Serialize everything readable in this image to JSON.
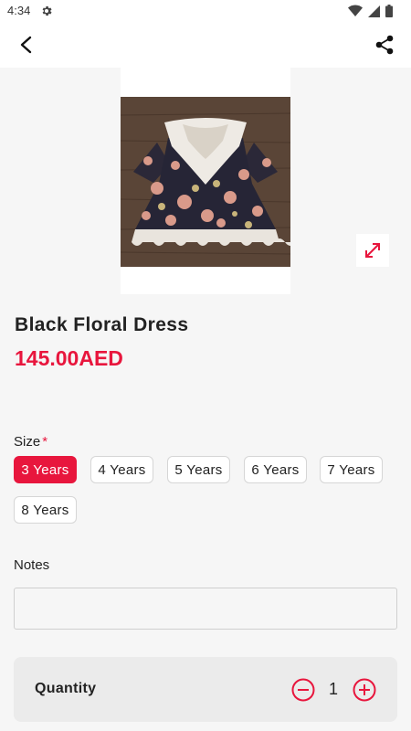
{
  "status_bar": {
    "time": "4:34"
  },
  "product": {
    "title": "Black Floral Dress",
    "price": "145.00AED"
  },
  "size": {
    "label": "Size",
    "required_mark": "*",
    "options": [
      "3 Years",
      "4 Years",
      "5 Years",
      "6 Years",
      "7 Years",
      "8 Years"
    ],
    "selected": "3 Years"
  },
  "notes": {
    "label": "Notes",
    "value": "",
    "placeholder": ""
  },
  "quantity": {
    "label": "Quantity",
    "value": "1"
  },
  "icons": {
    "back": "arrow-back-icon",
    "share": "share-icon",
    "expand": "expand-icon",
    "minus": "minus-circle-icon",
    "plus": "plus-circle-icon"
  },
  "colors": {
    "accent": "#e8163d",
    "background": "#f6f6f6"
  }
}
